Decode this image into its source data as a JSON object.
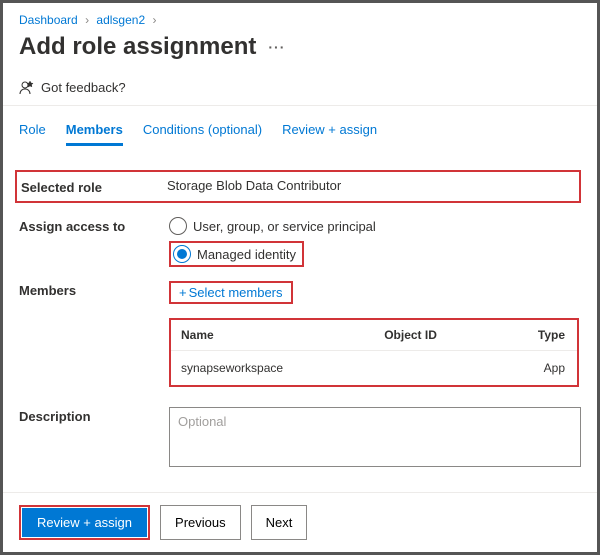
{
  "breadcrumb": {
    "dashboard": "Dashboard",
    "resource": "adlsgen2"
  },
  "page_title": "Add role assignment",
  "feedback_label": "Got feedback?",
  "tabs": {
    "role": "Role",
    "members": "Members",
    "conditions": "Conditions (optional)",
    "review": "Review + assign"
  },
  "labels": {
    "selected_role": "Selected role",
    "assign_access": "Assign access to",
    "members": "Members",
    "description": "Description"
  },
  "selected_role_value": "Storage Blob Data Contributor",
  "access_options": {
    "user": "User, group, or service principal",
    "managed": "Managed identity"
  },
  "select_members_label": "Select members",
  "table": {
    "headers": {
      "name": "Name",
      "object_id": "Object ID",
      "type": "Type"
    },
    "rows": [
      {
        "name": "synapseworkspace",
        "object_id": "",
        "type": "App"
      }
    ]
  },
  "description_placeholder": "Optional",
  "buttons": {
    "review": "Review + assign",
    "previous": "Previous",
    "next": "Next"
  }
}
